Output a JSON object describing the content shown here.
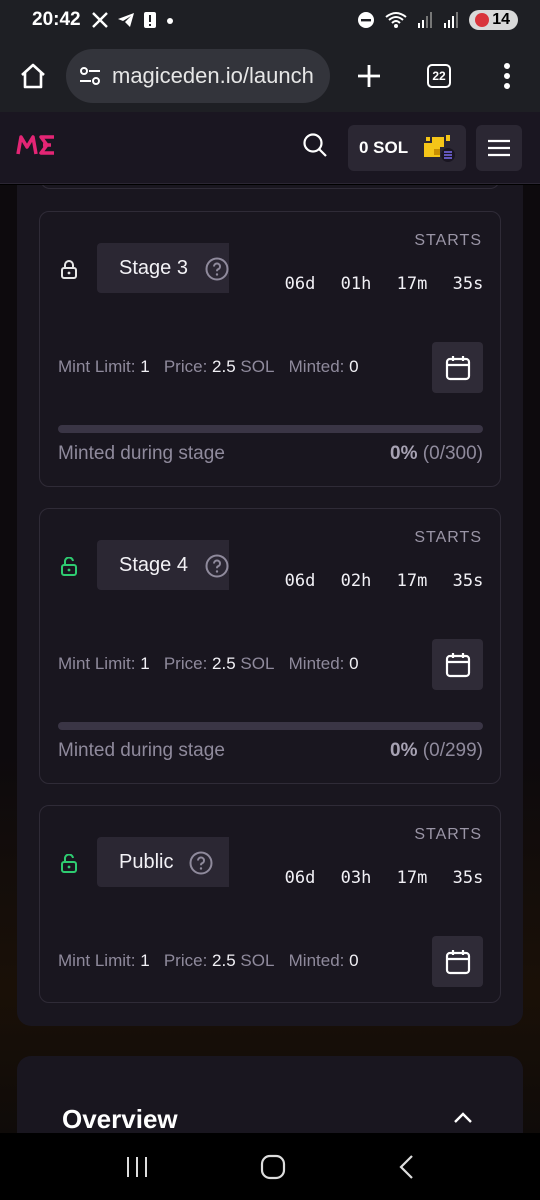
{
  "status_bar": {
    "time": "20:42",
    "battery": "14"
  },
  "browser": {
    "url": "magiceden.io/launch",
    "tabs_count": "22"
  },
  "header": {
    "balance": "0 SOL",
    "accent_color": "#e42575"
  },
  "stages": [
    {
      "name": "Stage 3",
      "lock": "locked",
      "starts_label": "STARTS",
      "countdown": [
        "06d",
        "01h",
        "17m",
        "35s"
      ],
      "mint_limit_label": "Mint Limit:",
      "mint_limit": "1",
      "price_label": "Price:",
      "price": "2.5",
      "price_unit": "SOL",
      "minted_label": "Minted:",
      "minted": "0",
      "minted_during_label": "Minted during stage",
      "minted_pct": "0%",
      "minted_count": "(0/300)",
      "progress": 0
    },
    {
      "name": "Stage 4",
      "lock": "unlocked",
      "starts_label": "STARTS",
      "countdown": [
        "06d",
        "02h",
        "17m",
        "35s"
      ],
      "mint_limit_label": "Mint Limit:",
      "mint_limit": "1",
      "price_label": "Price:",
      "price": "2.5",
      "price_unit": "SOL",
      "minted_label": "Minted:",
      "minted": "0",
      "minted_during_label": "Minted during stage",
      "minted_pct": "0%",
      "minted_count": "(0/299)",
      "progress": 0
    },
    {
      "name": "Public",
      "lock": "unlocked",
      "starts_label": "STARTS",
      "countdown": [
        "06d",
        "03h",
        "17m",
        "35s"
      ],
      "mint_limit_label": "Mint Limit:",
      "mint_limit": "1",
      "price_label": "Price:",
      "price": "2.5",
      "price_unit": "SOL",
      "minted_label": "Minted:",
      "minted": "0"
    }
  ],
  "overview": {
    "title": "Overview"
  },
  "colors": {
    "lock_locked": "#e6e6e6",
    "lock_unlocked": "#2ecc71"
  }
}
